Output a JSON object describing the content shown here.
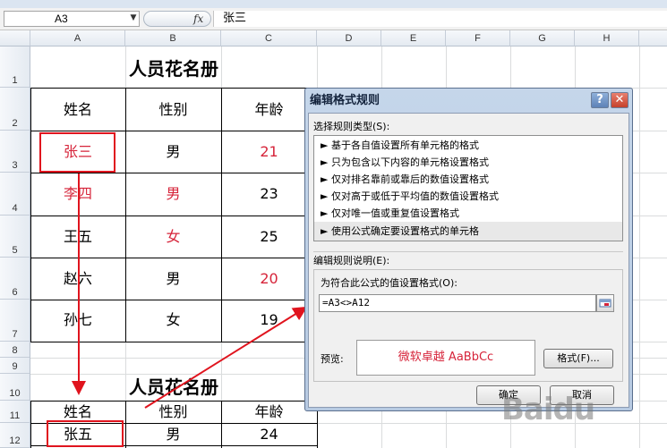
{
  "formula_bar": {
    "name_box": "A3",
    "fx_label": "fx",
    "content": "张三"
  },
  "columns": [
    "A",
    "B",
    "C",
    "D",
    "E",
    "F",
    "G",
    "H"
  ],
  "rows": [
    "1",
    "2",
    "3",
    "4",
    "5",
    "6",
    "7",
    "8",
    "9",
    "10",
    "11",
    "12"
  ],
  "table1": {
    "title": "人员花名册",
    "headers": [
      "姓名",
      "性别",
      "年龄"
    ],
    "rows": [
      [
        "张三",
        "男",
        "21"
      ],
      [
        "李四",
        "男",
        "23"
      ],
      [
        "王五",
        "女",
        "25"
      ],
      [
        "赵六",
        "男",
        "20"
      ],
      [
        "孙七",
        "女",
        "19"
      ]
    ]
  },
  "table2": {
    "title": "人员花名册",
    "headers": [
      "姓名",
      "性别",
      "年龄"
    ],
    "rows": [
      [
        "张五",
        "男",
        "24"
      ]
    ]
  },
  "colors": {
    "highlight_text": "#d6243a",
    "annotation": "#e0141e"
  },
  "dialog": {
    "title": "编辑格式规则",
    "help": "?",
    "close": "✕",
    "select_type_label": "选择规则类型(S):",
    "rule_types": [
      "► 基于各自值设置所有单元格的格式",
      "► 只为包含以下内容的单元格设置格式",
      "► 仅对排名靠前或靠后的数值设置格式",
      "► 仅对高于或低于平均值的数值设置格式",
      "► 仅对唯一值或重复值设置格式",
      "► 使用公式确定要设置格式的单元格"
    ],
    "edit_desc_label": "编辑规则说明(E):",
    "formula_label": "为符合此公式的值设置格式(O):",
    "formula_value": "=A3<>A12",
    "preview_label": "预览:",
    "preview_text": "微软卓越  AaBbCc",
    "format_button": "格式(F)...",
    "ok_button": "确定",
    "cancel_button": "取消"
  },
  "watermark": "Baidu"
}
